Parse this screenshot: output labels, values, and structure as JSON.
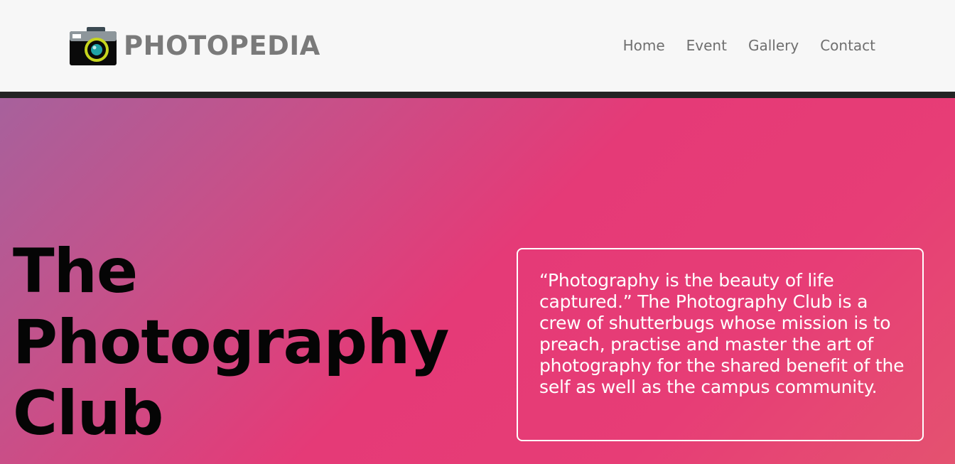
{
  "brand": {
    "name": "PHOTOPEDIA",
    "icon": "camera-icon"
  },
  "nav": {
    "items": [
      {
        "label": "Home"
      },
      {
        "label": "Event"
      },
      {
        "label": "Gallery"
      },
      {
        "label": "Contact"
      }
    ]
  },
  "hero": {
    "title_lines": [
      "The",
      "Photography",
      "Club"
    ],
    "quote": "“Photography is the beauty of life captured.” The Photography Club is a crew of shutterbugs whose mission is to preach, practise and master the art of photography for the shared benefit of the self as well as the campus community."
  },
  "colors": {
    "navbar_bg": "#f7f7f7",
    "divider": "#242424",
    "hero_gradient_start": "#a7619c",
    "hero_gradient_mid": "#e53a77",
    "hero_gradient_end": "#e45270",
    "brand_text": "#7a7a7a",
    "lens_ring": "#c6d51e"
  }
}
